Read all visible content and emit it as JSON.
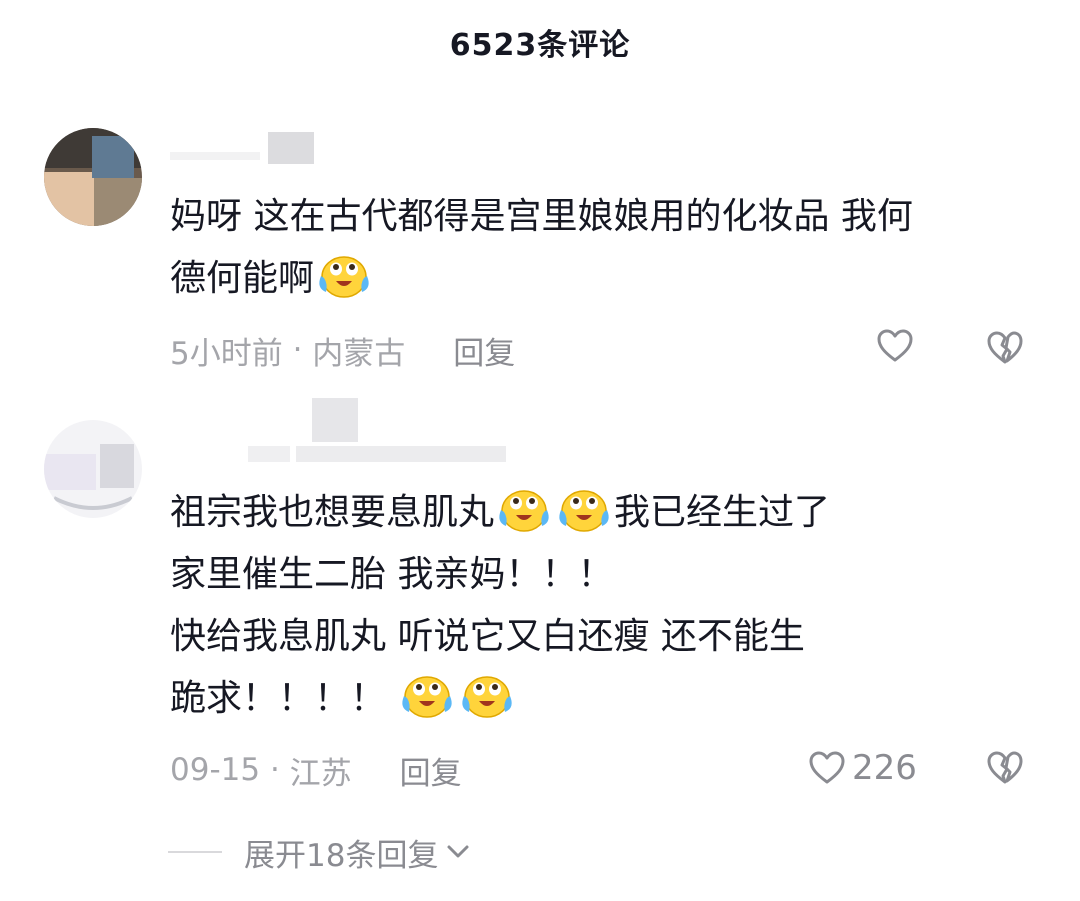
{
  "header": {
    "title": "6523条评论"
  },
  "comments": [
    {
      "text_lines": [
        {
          "pre": "妈呀 这在古代都得是宫里娘娘用的化妆品 我何",
          "emoji_count": 0,
          "post": ""
        },
        {
          "pre": "德何能啊",
          "emoji_count": 1,
          "post": ""
        }
      ],
      "time": "5小时前",
      "location": "内蒙古",
      "reply_label": "回复",
      "likes": ""
    },
    {
      "text_lines": [
        {
          "pre": "祖宗我也想要息肌丸",
          "emoji_count": 2,
          "post": "我已经生过了"
        },
        {
          "pre": "家里催生二胎 我亲妈！！！",
          "emoji_count": 0,
          "post": ""
        },
        {
          "pre": "快给我息肌丸 听说它又白还瘦 还不能生",
          "emoji_count": 0,
          "post": ""
        },
        {
          "pre": "跪求！！！！ ",
          "emoji_count": 2,
          "post": ""
        }
      ],
      "time": "09-15",
      "location": "江苏",
      "reply_label": "回复",
      "likes": "226"
    }
  ],
  "separator": " · ",
  "expand_label": "展开18条回复",
  "icons": {
    "like": "heart-outline-icon",
    "dislike": "broken-heart-icon",
    "expand": "chevron-down-icon",
    "emoji": "crying-laughing-emoji"
  },
  "colors": {
    "text": "#161823",
    "meta": "#a4a5aa",
    "action": "#8a8b91"
  }
}
